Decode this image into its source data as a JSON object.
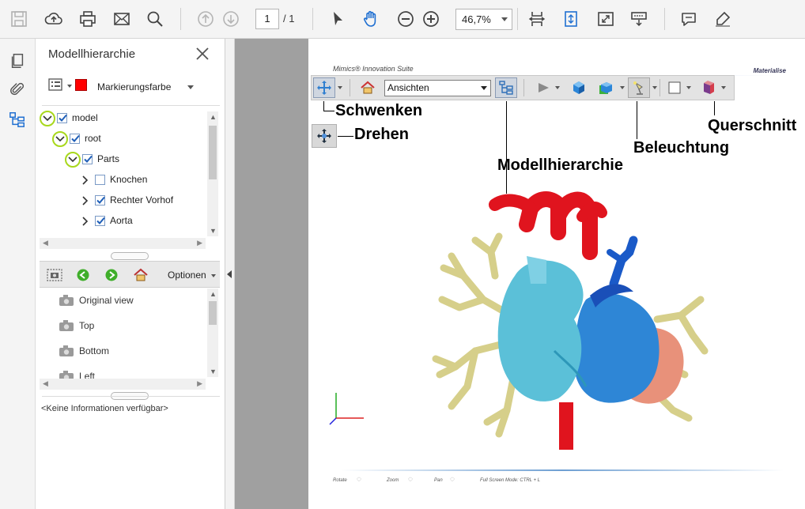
{
  "toolbar": {
    "page_current": "1",
    "page_total": "/ 1",
    "zoom": "46,7%"
  },
  "panel": {
    "title": "Modellhierarchie",
    "marker_label": "Markierungsfarbe",
    "marker_color": "#ff0000",
    "tree": [
      {
        "label": "model",
        "checked": true
      },
      {
        "label": "root",
        "checked": true
      },
      {
        "label": "Parts",
        "checked": true
      },
      {
        "label": "Knochen",
        "checked": false
      },
      {
        "label": "Rechter Vorhof",
        "checked": true
      },
      {
        "label": "Aorta",
        "checked": true
      }
    ],
    "views_toolbar_label": "Optionen",
    "views": [
      "Original view",
      "Top",
      "Bottom",
      "Left"
    ],
    "info": "<Keine Informationen verfügbar>"
  },
  "document": {
    "brand": "Mimics® Innovation Suite",
    "logo": "Materialise",
    "viewer_toolbar": {
      "views_dropdown": "Ansichten"
    },
    "callouts": {
      "pan": "Schwenken",
      "rotate": "Drehen",
      "hierarchy": "Modellhierarchie",
      "lighting": "Beleuchtung",
      "cross_section": "Querschnitt"
    },
    "bottom_bar": {
      "rotate": "Rotate",
      "zoom": "Zoom",
      "pan": "Pan",
      "fullscreen": "Full Screen Mode:  CTRL + L"
    }
  },
  "colors": {
    "accent_ring": "#a8d81c",
    "doc_background": "#a0a0a0",
    "aorta": "#e0141e",
    "atrium": "#5bc0d8",
    "ventricle": "#2e86d6",
    "lung_vessels": "#d6cf8a",
    "left_ventricle": "#e8917a"
  }
}
